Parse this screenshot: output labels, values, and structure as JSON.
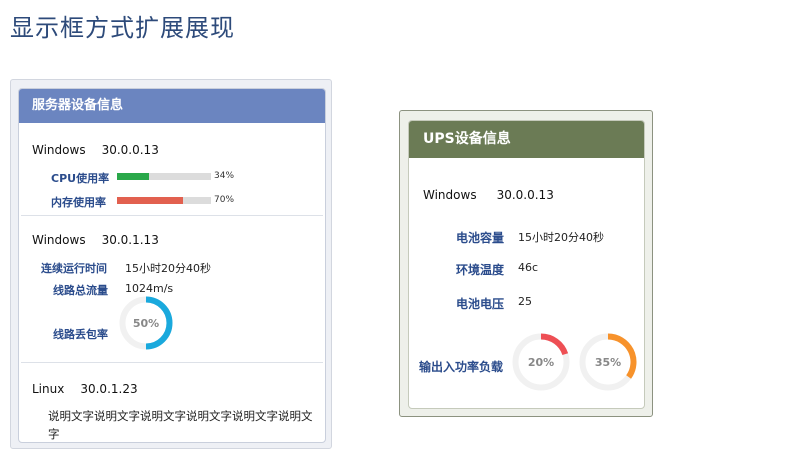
{
  "page": {
    "title": "显示框方式扩展展现"
  },
  "server": {
    "title": "服务器设备信息",
    "host1": {
      "os": "Windows",
      "ip": "30.0.0.13",
      "cpu": {
        "label": "CPU使用率",
        "value": 34,
        "text": "34%",
        "color": "#2aa84a"
      },
      "mem": {
        "label": "内存使用率",
        "value": 70,
        "text": "70%",
        "color": "#e2604f"
      }
    },
    "host2": {
      "os": "Windows",
      "ip": "30.0.1.13",
      "uptime_label": "连续运行时间",
      "uptime": "15小时20分40秒",
      "traffic_label": "线路总流量",
      "traffic": "1024m/s",
      "loss_label": "线路丢包率",
      "loss": {
        "value": 50,
        "text": "50%",
        "color": "#1aa9dd"
      }
    },
    "host3": {
      "os": "Linux",
      "ip": "30.0.1.23",
      "description": "说明文字说明文字说明文字说明文字说明文字说明文字"
    }
  },
  "ups": {
    "title": "UPS设备信息",
    "os": "Windows",
    "ip": "30.0.0.13",
    "capacity_label": "电池容量",
    "capacity": "15小时20分40秒",
    "temp_label": "环境温度",
    "temp": "46c",
    "voltage_label": "电池电压",
    "voltage": "25",
    "load_label": "输出入功率负载",
    "load1": {
      "value": 20,
      "text": "20%",
      "color": "#ee4f54"
    },
    "load2": {
      "value": 35,
      "text": "35%",
      "color": "#f7922b"
    }
  }
}
